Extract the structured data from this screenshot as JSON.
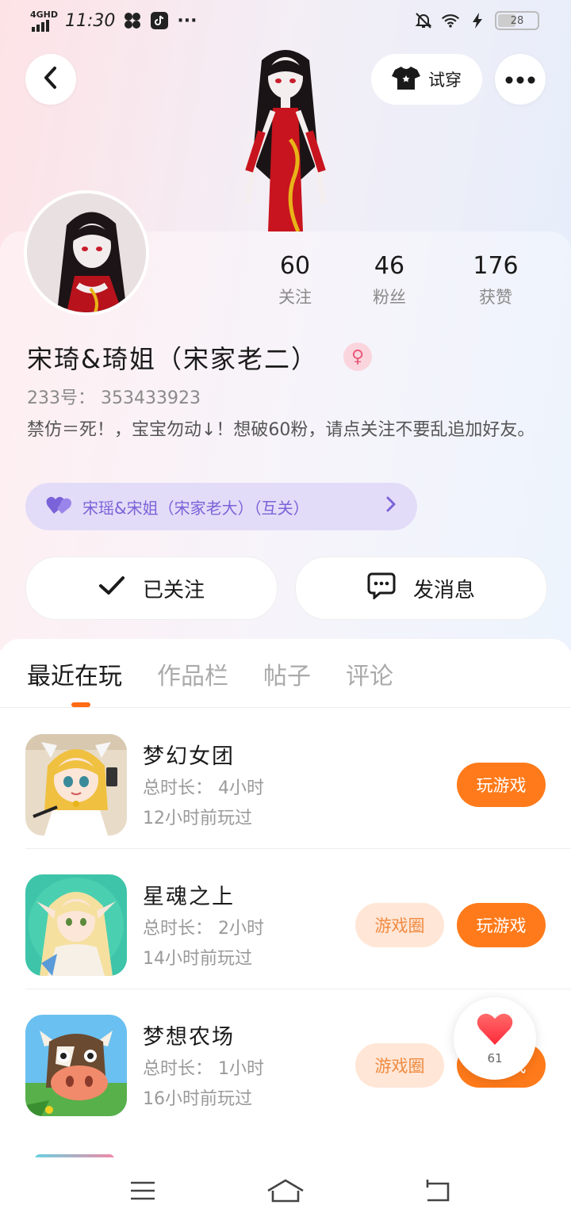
{
  "status_bar": {
    "network": "4GHD",
    "time": "11:30",
    "battery": "28",
    "more": "···"
  },
  "header": {
    "try_on_label": "试穿",
    "back_icon": "chevron-left-icon",
    "more_icon": "more-horizontal-icon"
  },
  "profile": {
    "stats": [
      {
        "value": "60",
        "label": "关注"
      },
      {
        "value": "46",
        "label": "粉丝"
      },
      {
        "value": "176",
        "label": "获赞"
      }
    ],
    "nickname": "宋琦&琦姐（宋家老二）",
    "gender_symbol": "♀",
    "uid": "233号： 353433923",
    "bio": "禁仿＝死！，宝宝勿动↓！想破60粉，请点关注不要乱追加好友。",
    "relation": "宋瑶&宋姐（宋家老大）（互关）",
    "follow_label": "已关注",
    "message_label": "发消息"
  },
  "tabs": [
    {
      "label": "最近在玩",
      "active": true
    },
    {
      "label": "作品栏",
      "active": false
    },
    {
      "label": "帖子",
      "active": false
    },
    {
      "label": "评论",
      "active": false
    }
  ],
  "games": [
    {
      "title": "梦幻女团",
      "duration": "总时长： 4小时",
      "last_played": "12小时前玩过",
      "circle_label": "",
      "play_label": "玩游戏"
    },
    {
      "title": "星魂之上",
      "duration": "总时长： 2小时",
      "last_played": "14小时前玩过",
      "circle_label": "游戏圈",
      "play_label": "玩游戏"
    },
    {
      "title": "梦想农场",
      "duration": "总时长： 1小时",
      "last_played": "16小时前玩过",
      "circle_label": "游戏圈",
      "play_label": "玩游戏"
    }
  ],
  "like_float": {
    "count": "61"
  },
  "colors": {
    "accent": "#ff7a1a",
    "relation": "#7a63d8",
    "gender": "#e55a7a"
  }
}
